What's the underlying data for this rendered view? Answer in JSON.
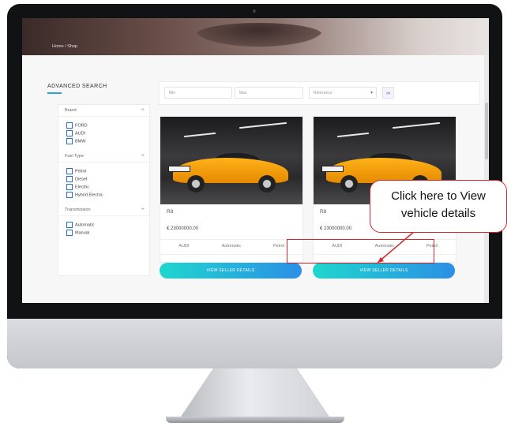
{
  "breadcrumb": "Home / Shop",
  "sidebar": {
    "title": "ADVANCED SEARCH",
    "sections": [
      {
        "label": "Brand",
        "options": [
          "FORD",
          "AUDI",
          "BMW"
        ]
      },
      {
        "label": "Fuel Type",
        "options": [
          "Petrol",
          "Diesel",
          "Electric",
          "Hybrid Electric"
        ]
      },
      {
        "label": "Transmission",
        "options": [
          "Automatic",
          "Manual"
        ]
      }
    ],
    "toggle_icon": "plus-icon"
  },
  "search": {
    "field1_placeholder": "Min",
    "field2_placeholder": "Max",
    "sort_value": "Relevance",
    "link_icon": "infinity-icon"
  },
  "cards": [
    {
      "title": "R8",
      "price": "€ 23000000.00",
      "specs": [
        "AUDI",
        "Automatic",
        "Petrol"
      ],
      "button": "VIEW SELLER DETAILS"
    },
    {
      "title": "R8",
      "price": "€ 23000000.00",
      "specs": [
        "AUDI",
        "Automatic",
        "Petrol"
      ],
      "button": "VIEW SELLER DETAILS"
    }
  ],
  "callout": {
    "line1": "Click here to View",
    "line2": "vehicle details"
  },
  "colors": {
    "accent": "#2b8fe6",
    "highlight": "#d7262a",
    "button_start": "#1fd6cf"
  }
}
